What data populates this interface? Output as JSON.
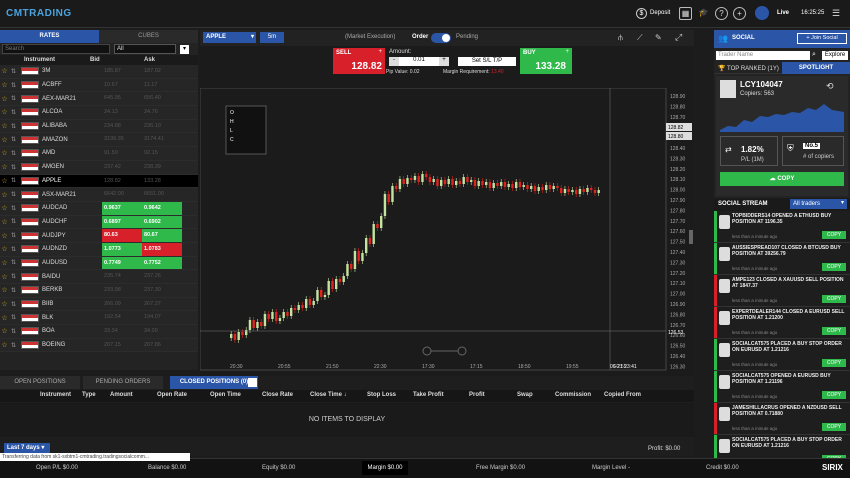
{
  "topbar": {
    "logo": "CMTRADING",
    "deposit": "Deposit",
    "live": "Live",
    "time": "16:25:25"
  },
  "left": {
    "tab_rates": "RATES",
    "tab_cubes": "CUBES",
    "search_placeholder": "Search",
    "filter": "All",
    "hdr_instrument": "Instrument",
    "hdr_bid": "Bid",
    "hdr_ask": "Ask",
    "rows": [
      {
        "name": "3M",
        "bid": "185.87",
        "ask": "187.02",
        "style": ""
      },
      {
        "name": "ACBFF",
        "bid": "10.67",
        "ask": "11.17",
        "style": ""
      },
      {
        "name": "AEX-MAR21",
        "bid": "645.95",
        "ask": "656.40",
        "style": ""
      },
      {
        "name": "ALCOA",
        "bid": "24.13",
        "ask": "24.76",
        "style": ""
      },
      {
        "name": "ALIBABA",
        "bid": "234.88",
        "ask": "236.10",
        "style": ""
      },
      {
        "name": "AMAZON",
        "bid": "3199.35",
        "ask": "3174.41",
        "style": ""
      },
      {
        "name": "AMD",
        "bid": "91.50",
        "ask": "92.15",
        "style": ""
      },
      {
        "name": "AMGEN",
        "bid": "237.42",
        "ask": "238.39",
        "style": ""
      },
      {
        "name": "APPLE",
        "bid": "128.82",
        "ask": "133.28",
        "style": "sel"
      },
      {
        "name": "ASX-MAR21",
        "bid": "6642.00",
        "ask": "6651.00",
        "style": ""
      },
      {
        "name": "AUDCAD",
        "bid": "0.9637",
        "ask": "0.9642",
        "style": "gg"
      },
      {
        "name": "AUDCHF",
        "bid": "0.6897",
        "ask": "0.6902",
        "style": "gg"
      },
      {
        "name": "AUDJPY",
        "bid": "80.63",
        "ask": "80.67",
        "style": "rg"
      },
      {
        "name": "AUDNZD",
        "bid": "1.0773",
        "ask": "1.0783",
        "style": "gr"
      },
      {
        "name": "AUDUSD",
        "bid": "0.7749",
        "ask": "0.7752",
        "style": "gg"
      },
      {
        "name": "BAIDU",
        "bid": "235.74",
        "ask": "237.26",
        "style": ""
      },
      {
        "name": "BERKB",
        "bid": "233.98",
        "ask": "237.30",
        "style": ""
      },
      {
        "name": "BIIB",
        "bid": "266.09",
        "ask": "267.27",
        "style": ""
      },
      {
        "name": "BLK",
        "bid": "192.54",
        "ask": "194.07",
        "style": ""
      },
      {
        "name": "BOA",
        "bid": "33.34",
        "ask": "34.00",
        "style": ""
      },
      {
        "name": "BOEING",
        "bid": "207.15",
        "ask": "207.86",
        "style": ""
      }
    ]
  },
  "chart": {
    "symbol": "APPLE",
    "timeframe": "5m",
    "exec": "(Market Execution)",
    "order": "Order",
    "pending": "Pending",
    "sell_label": "SELL",
    "sell_price": "128.82",
    "buy_label": "BUY",
    "buy_price": "133.28",
    "amount_label": "Amount:",
    "amount_value": "0.01",
    "setsl": "Set S/L T/P",
    "pip": "Pip Value: 0.02",
    "margin_req": "Margin Requirement: ",
    "margin_val": "13.40",
    "ohlc": [
      "O",
      "H",
      "L",
      "C"
    ],
    "time_labels": [
      "20:30",
      "20:55",
      "21:50",
      "22:30",
      "17:30",
      "17:15",
      "18:50",
      "19:55",
      "22:55"
    ],
    "y_labels": [
      "128.90",
      "128.80",
      "128.70",
      "128.60",
      "128.50",
      "128.40",
      "128.30",
      "128.20",
      "128.10",
      "128.00",
      "127.90",
      "127.80",
      "127.70",
      "127.60",
      "127.50",
      "127.40",
      "127.30",
      "127.20",
      "127.10",
      "127.00",
      "126.90",
      "126.80",
      "126.70",
      "126.60",
      "126.50",
      "126.40",
      "126.30"
    ],
    "cur_price1": "128.82",
    "cur_price2": "128.80",
    "cross_time": "06-21 23:41",
    "low_price": "126.53"
  },
  "bottom": {
    "tabs": [
      "OPEN POSITIONS",
      "PENDING ORDERS",
      "CLOSED POSITIONS (0)"
    ],
    "cols": [
      "Instrument",
      "Type",
      "Amount",
      "Open Rate",
      "Open Time",
      "Close Rate",
      "Close Time ↓",
      "Stop Loss",
      "Take Profit",
      "Profit",
      "Swap",
      "Commission",
      "Copied From"
    ],
    "empty": "NO ITEMS TO DISPLAY",
    "range": "Last 7 days",
    "profit": "Profit: $0.00"
  },
  "status": {
    "open_pl": "Open P/L $0.00",
    "balance": "Balance $0.00",
    "equity": "Equity $0.00",
    "margin": "Margin $0.00",
    "free_margin": "Free Margin $0.00",
    "margin_level": "Margin Level -",
    "credit": "Credit $0.00",
    "brand": "SIRIX",
    "loading": "Transferring data from sk1-sxbtm1-cmtrading.tradingsocialcomm..."
  },
  "social": {
    "title": "SOCIAL",
    "join": "+ Join Social",
    "search_placeholder": "Trader Name",
    "explore": "Explore",
    "top_ranked": "TOP RANKED (1Y)",
    "spotlight": "SPOTLIGHT",
    "trader": "LCY104047",
    "copiers": "Copiers: 563",
    "pl_value": "1.82%",
    "pl_label": "P/L (1M)",
    "rank": "No.5",
    "rank_label": "# of copiers",
    "copy": "COPY",
    "stream": "SOCIAL STREAM",
    "stream_filter": "All traders",
    "items": [
      {
        "text": "TOPBIDDERS14 OPENED A ETHUSD BUY POSITION AT 1196.35",
        "bar": "#2eb94a"
      },
      {
        "text": "AUSSIESPREAD107 CLOSED A BTCUSD BUY POSITION AT 39256.79",
        "bar": "#2eb94a"
      },
      {
        "text": "AMPE123 CLOSED A XAUUSD SELL POSITION AT 1847.37",
        "bar": "#d8202b"
      },
      {
        "text": "EXPERTDEALER144 CLOSED A EURUSD SELL POSITION AT 1.21200",
        "bar": "#d8202b"
      },
      {
        "text": "SOCIALCAT575 PLACED A BUY STOP ORDER ON EURUSD AT 1.21216",
        "bar": "#2eb94a"
      },
      {
        "text": "SOCIALCAT575 OPENED A EURUSD BUY POSITION AT 1.21196",
        "bar": "#2eb94a"
      },
      {
        "text": "JAMESHILLACRUS OPENED A NZDUSD SELL POSITION AT 0.71880",
        "bar": "#d8202b"
      },
      {
        "text": "SOCIALCAT575 PLACED A BUY STOP ORDER ON EURUSD AT 1.21216",
        "bar": "#2eb94a"
      }
    ],
    "time_ago": "less than a minute ago"
  }
}
